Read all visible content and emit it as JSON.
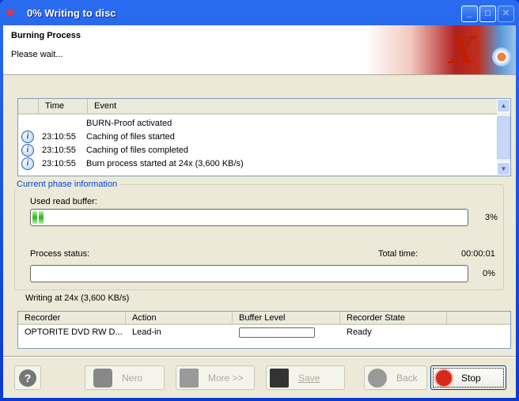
{
  "window": {
    "title": "0% Writing to disc",
    "app_icon": "nero-flame-icon"
  },
  "header": {
    "title": "Burning Process",
    "subtitle": "Please wait...",
    "brand_logo": "X"
  },
  "log": {
    "columns": [
      "",
      "Time",
      "Event"
    ],
    "rows": [
      {
        "icon": "",
        "time": "",
        "event": "BURN-Proof activated"
      },
      {
        "icon": "info-icon",
        "time": "23:10:55",
        "event": "Caching of files started"
      },
      {
        "icon": "info-icon",
        "time": "23:10:55",
        "event": "Caching of files completed"
      },
      {
        "icon": "info-icon",
        "time": "23:10:55",
        "event": "Burn process started at 24x (3,600 KB/s)"
      }
    ]
  },
  "phase": {
    "group_label": "Current phase information",
    "buffer_label": "Used read buffer:",
    "buffer_percent": 3,
    "buffer_text": "3%",
    "process_label": "Process status:",
    "total_time_label": "Total time:",
    "total_time": "00:00:01",
    "process_percent": 0,
    "process_text": "0%"
  },
  "status_text": "Writing at 24x (3,600 KB/s)",
  "recorder": {
    "columns": [
      "Recorder",
      "Action",
      "Buffer Level",
      "Recorder State"
    ],
    "rows": [
      {
        "recorder": "OPTORITE DVD RW D...",
        "action": "Lead-in",
        "buffer_level": 0,
        "state": "Ready"
      }
    ]
  },
  "buttons": {
    "help": "?",
    "nero": "Nero",
    "more": "More >>",
    "save": "Save",
    "back": "Back",
    "stop": "Stop"
  },
  "colors": {
    "title_bar": "#0a3bd0",
    "group_label": "#0046d5",
    "progress_green": "#2fb41c",
    "stop_red": "#d42a1a"
  }
}
